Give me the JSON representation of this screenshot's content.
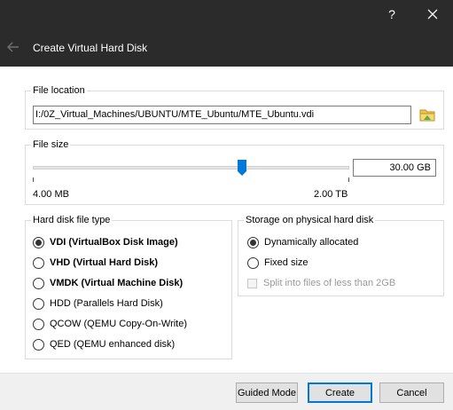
{
  "window": {
    "title": "Create Virtual Hard Disk",
    "help_label": "?",
    "close_label": "✕"
  },
  "file_location": {
    "label": "File location",
    "path": "I:/0Z_Virtual_Machines/UBUNTU/MTE_Ubuntu/MTE_Ubuntu.vdi"
  },
  "file_size": {
    "label": "File size",
    "value": "30.00 GB",
    "min_label": "4.00 MB",
    "max_label": "2.00 TB",
    "slider_fraction": 0.66
  },
  "disk_type": {
    "label": "Hard disk file type",
    "options": [
      {
        "label": "VDI (VirtualBox Disk Image)",
        "checked": true,
        "bold": true
      },
      {
        "label": "VHD (Virtual Hard Disk)",
        "checked": false,
        "bold": true
      },
      {
        "label": "VMDK (Virtual Machine Disk)",
        "checked": false,
        "bold": true
      },
      {
        "label": "HDD (Parallels Hard Disk)",
        "checked": false,
        "bold": false
      },
      {
        "label": "QCOW (QEMU Copy-On-Write)",
        "checked": false,
        "bold": false
      },
      {
        "label": "QED (QEMU enhanced disk)",
        "checked": false,
        "bold": false
      }
    ]
  },
  "storage": {
    "label": "Storage on physical hard disk",
    "options": [
      {
        "label": "Dynamically allocated",
        "checked": true
      },
      {
        "label": "Fixed size",
        "checked": false
      }
    ],
    "split_label": "Split into files of less than 2GB"
  },
  "buttons": {
    "guided": "Guided Mode",
    "create": "Create",
    "cancel": "Cancel"
  },
  "colors": {
    "titlebar": "#2b2b2b",
    "slider_thumb": "#0078d7",
    "footer": "#f0f0f0"
  },
  "icons": [
    "back-arrow-icon",
    "help-icon",
    "close-icon",
    "folder-browse-icon"
  ]
}
